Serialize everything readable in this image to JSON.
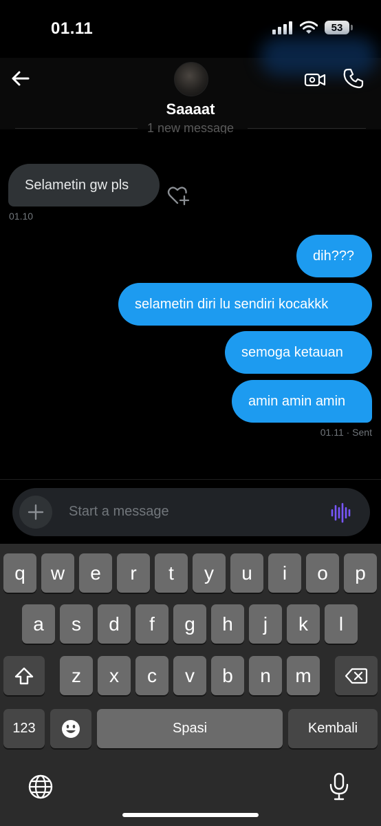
{
  "status_bar": {
    "time": "01.11",
    "battery": "53"
  },
  "header": {
    "contact_name": "Saaaat"
  },
  "divider": {
    "text": "1 new message"
  },
  "messages": [
    {
      "text": "Selametin gw pls",
      "direction": "incoming"
    },
    {
      "text": "dih???",
      "direction": "outgoing"
    },
    {
      "text": "selametin diri lu sendiri kocakkk",
      "direction": "outgoing"
    },
    {
      "text": "semoga ketauan",
      "direction": "outgoing"
    },
    {
      "text": "amin amin amin",
      "direction": "outgoing"
    }
  ],
  "timestamps": {
    "incoming": "01.10",
    "outgoing": "01.11 · Sent"
  },
  "composer": {
    "placeholder": "Start a message"
  },
  "keyboard": {
    "row1": [
      "q",
      "w",
      "e",
      "r",
      "t",
      "y",
      "u",
      "i",
      "o",
      "p"
    ],
    "row2": [
      "a",
      "s",
      "d",
      "f",
      "g",
      "h",
      "j",
      "k",
      "l"
    ],
    "row3": [
      "z",
      "x",
      "c",
      "v",
      "b",
      "n",
      "m"
    ],
    "numbers_key": "123",
    "space_key": "Spasi",
    "return_key": "Kembali"
  },
  "icons": {
    "back": "arrow-left-icon",
    "video": "video-camera-icon",
    "phone": "phone-icon",
    "react": "heart-plus-icon",
    "add": "plus-icon",
    "voice": "voice-wave-icon",
    "shift": "shift-icon",
    "delete": "backspace-icon",
    "emoji": "emoji-icon",
    "globe": "globe-icon",
    "mic": "microphone-icon"
  },
  "colors": {
    "accent": "#1d9bf0",
    "incoming_bubble": "#2f3336",
    "voice_icon": "#7856ff"
  }
}
